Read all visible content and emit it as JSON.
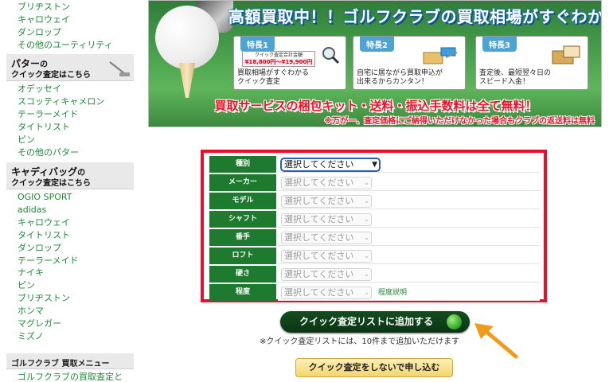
{
  "sidebar": {
    "top_links": [
      "ブリヂストン",
      "キャロウェイ",
      "ダンロップ",
      "その他のユーティリティ"
    ],
    "putter_head": {
      "title": "パター",
      "suffix": "の",
      "sub": "クイック査定はこちら"
    },
    "putter_links": [
      "オデッセイ",
      "スコッティキャメロン",
      "テーラーメイド",
      "タイトリスト",
      "ピン",
      "その他のパター"
    ],
    "bag_head": {
      "title": "キャディバッグ",
      "suffix": "の",
      "sub": "クイック査定はこちら"
    },
    "bag_links": [
      "OGIO SPORT",
      "adidas",
      "キャロウェイ",
      "タイトリスト",
      "ダンロップ",
      "テーラーメイド",
      "ナイキ",
      "ピン",
      "ブリヂストン",
      "ホンマ",
      "マグレガー",
      "ミズノ"
    ],
    "menu_head": "ゴルフクラブ 買取メニュー",
    "menu_links": [
      "ゴルフクラブの買取査定と"
    ]
  },
  "banner": {
    "headline": "高額買取中！！ゴルフクラブの買取相場がすぐわかる",
    "features": [
      {
        "badge": "特長1",
        "price_label": "クイック査定合計金額",
        "price": "¥18,800円〜¥19,900円",
        "desc": "買取相場がすぐわかる\nクイック査定"
      },
      {
        "badge": "特長2",
        "desc": "自宅に居ながら買取申込が\n出来るからカンタン！"
      },
      {
        "badge": "特長3",
        "desc": "査定後、最短翌々日の\nスピード入金！"
      }
    ],
    "bottom_main": "買取サービスの梱包キット・送料・振込手数料は全て無料！",
    "bottom_note": "※万が一、査定価格にご納得いただけなかった場合もクラブの返送料は無料"
  },
  "form": {
    "rows": [
      {
        "label": "種別",
        "value": "選択してください",
        "active": true
      },
      {
        "label": "メーカー",
        "value": "選択してください"
      },
      {
        "label": "モデル",
        "value": "選択してください"
      },
      {
        "label": "シャフト",
        "value": "選択してください"
      },
      {
        "label": "番手",
        "value": "選択してください"
      },
      {
        "label": "ロフト",
        "value": "選択してください"
      },
      {
        "label": "硬さ",
        "value": "選択してください"
      },
      {
        "label": "程度",
        "value": "選択してください",
        "help": "程度説明"
      }
    ]
  },
  "actions": {
    "add_label": "クイック査定リストに追加する",
    "note": "※クイック査定リストには、10件まで追加いただけます",
    "apply_label": "クイック査定をしないで申し込む"
  },
  "colors": {
    "accent_green": "#1e7a2e",
    "link_green": "#1f8a3a",
    "form_border": "#e8102e",
    "arrow": "#f29a1a"
  }
}
